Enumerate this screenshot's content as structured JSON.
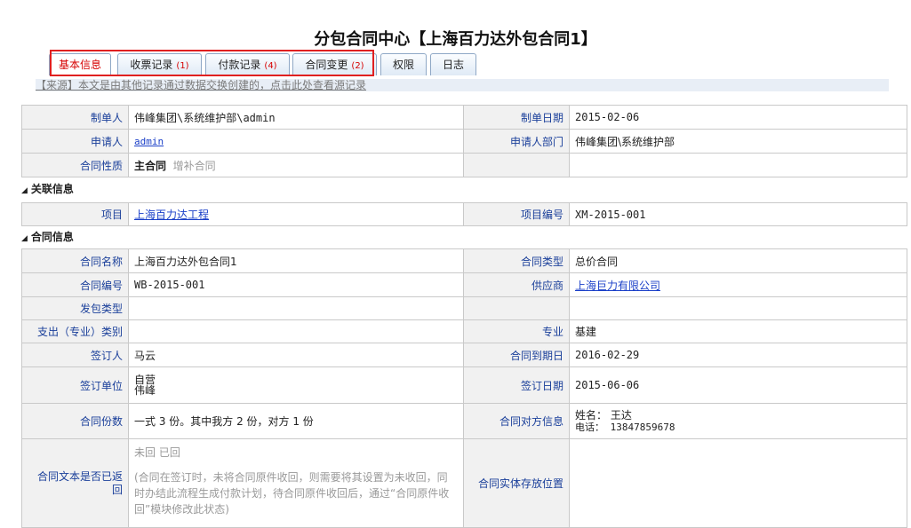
{
  "page": {
    "title": "分包合同中心【上海百力达外包合同1】"
  },
  "tabs": [
    {
      "label": "基本信息",
      "count": ""
    },
    {
      "label": "收票记录",
      "count": "(1)"
    },
    {
      "label": "付款记录",
      "count": "(4)"
    },
    {
      "label": "合同变更",
      "count": "(2)"
    },
    {
      "label": "权限",
      "count": ""
    },
    {
      "label": "日志",
      "count": ""
    }
  ],
  "source_notice": "【来源】本文是由其他记录通过数据交换创建的，点击此处查看源记录",
  "basic": {
    "creator_label": "制单人",
    "creator_value": "伟峰集团\\系统维护部\\admin",
    "create_date_label": "制单日期",
    "create_date_value": "2015-02-06",
    "applicant_label": "申请人",
    "applicant_value": "admin",
    "applicant_dept_label": "申请人部门",
    "applicant_dept_value": "伟峰集团\\系统维护部",
    "nature_label": "合同性质",
    "nature_main": "主合同",
    "nature_supp": "增补合同"
  },
  "related": {
    "section_title": "关联信息",
    "project_label": "项目",
    "project_value": "上海百力达工程",
    "project_no_label": "项目编号",
    "project_no_value": "XM-2015-001"
  },
  "contract": {
    "section_title": "合同信息",
    "name_label": "合同名称",
    "name_value": "上海百力达外包合同1",
    "type_label": "合同类型",
    "type_value": "总价合同",
    "no_label": "合同编号",
    "no_value": "WB-2015-001",
    "supplier_label": "供应商",
    "supplier_value": "上海巨力有限公司",
    "subcontract_type_label": "发包类型",
    "expense_label": "支出（专业）类别",
    "specialty_label": "专业",
    "specialty_value": "基建",
    "signer_label": "签订人",
    "signer_value": "马云",
    "expire_label": "合同到期日",
    "expire_value": "2016-02-29",
    "sign_unit_label": "签订单位",
    "sign_unit_line1": "自营",
    "sign_unit_line2": "伟峰",
    "sign_date_label": "签订日期",
    "sign_date_value": "2015-06-06",
    "copies_label": "合同份数",
    "copies_value": "一式 3 份。其中我方 2 份，对方 1 份",
    "counterparty_label": "合同对方信息",
    "counterparty_name": "姓名： 王达",
    "counterparty_phone": "电话： 13847859678",
    "returned_label": "合同文本是否已返回",
    "returned_options": "未回  已回",
    "returned_note": "(合同在签订时，未将合同原件收回，则需要将其设置为未收回，同时办结此流程生成付款计划，待合同原件收回后，通过“合同原件收回”模块修改此状态)",
    "storage_label": "合同实体存放位置"
  }
}
